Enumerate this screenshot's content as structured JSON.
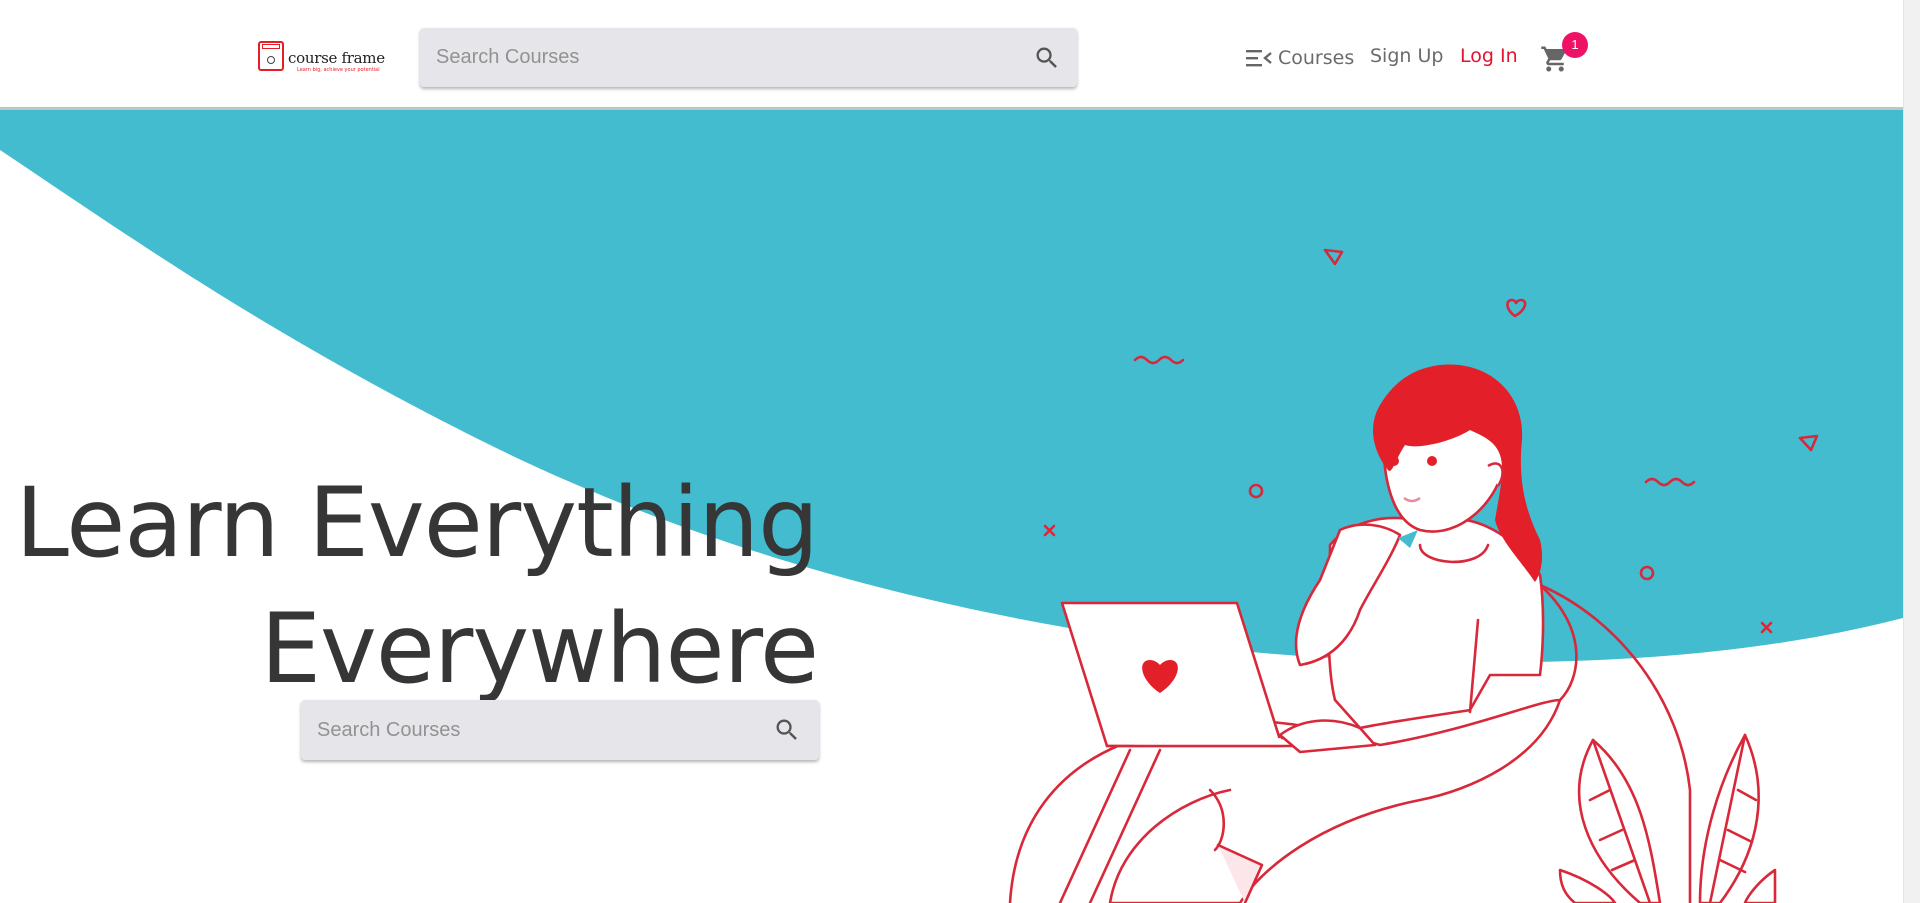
{
  "brand": {
    "name": "course frame",
    "tagline": "Learn big, achieve your potential"
  },
  "header": {
    "search_placeholder": "Search Courses",
    "nav": {
      "courses_label": "Courses",
      "signup_label": "Sign Up",
      "login_label": "Log In"
    },
    "cart_count": "1"
  },
  "hero": {
    "title_line1": "Learn Everything",
    "title_line2": "Everywhere",
    "search_placeholder": "Search Courses"
  },
  "icons": {
    "menu": "menu-open-icon",
    "search": "search-icon",
    "cart": "shopping-cart-icon"
  },
  "colors": {
    "accent_red": "#e2132f",
    "hero_teal": "#43bccf",
    "badge_pink": "#ee1166",
    "text_dark": "#363636"
  }
}
